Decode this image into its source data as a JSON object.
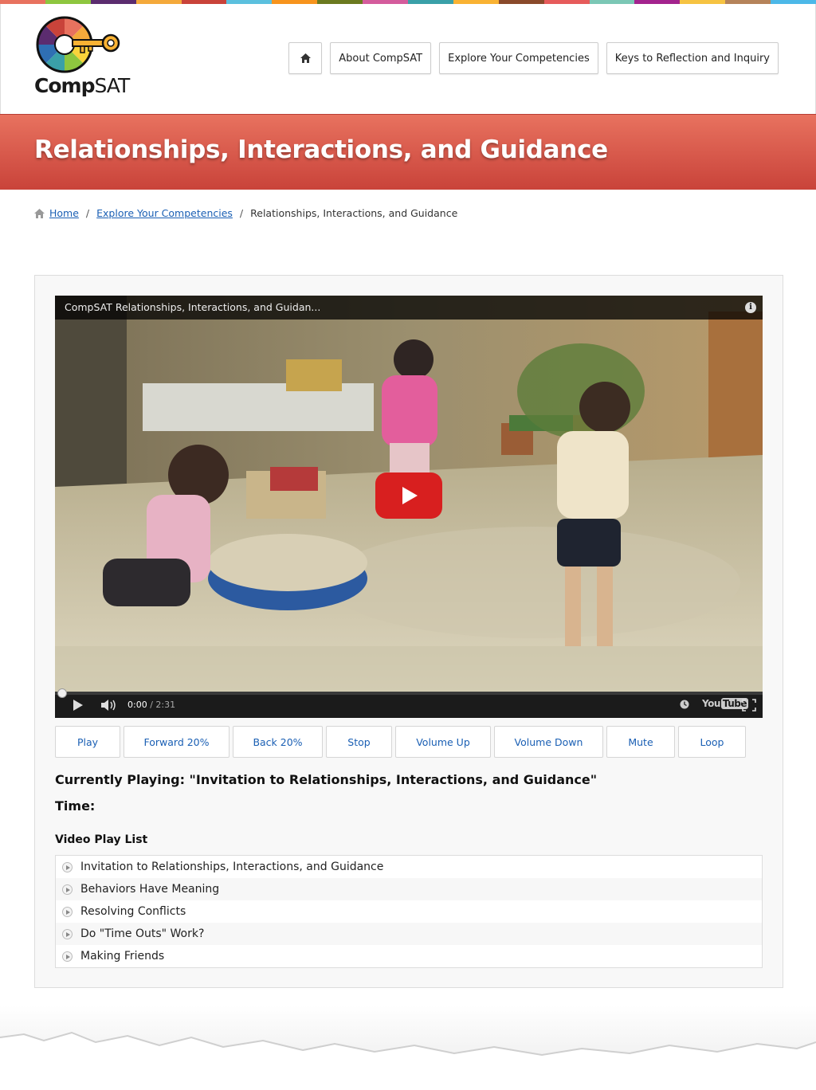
{
  "brand": {
    "logo_text_bold": "Comp",
    "logo_text_light": "SAT",
    "stripe_colors": [
      "#e8725f",
      "#8ec63f",
      "#5b2c6f",
      "#f4a93b",
      "#c9433a",
      "#5bc0de",
      "#f7941d",
      "#6b7a1f",
      "#d45c9c",
      "#3aa0a8",
      "#f9b233",
      "#8a4a2b",
      "#e65b5b",
      "#7bc7b5",
      "#a3238e",
      "#f6c342",
      "#b5835a",
      "#4cb8e8"
    ],
    "accent": "#c9433a",
    "link": "#1a5fb4"
  },
  "nav": {
    "home_icon": "home-icon",
    "items": [
      {
        "label": "About CompSAT"
      },
      {
        "label": "Explore Your Competencies"
      },
      {
        "label": "Keys to Reflection and Inquiry"
      }
    ]
  },
  "banner": {
    "title": "Relationships, Interactions, and Guidance"
  },
  "breadcrumb": {
    "home": "Home",
    "sep": "/",
    "parent": "Explore Your Competencies",
    "current": "Relationships, Interactions, and Guidance"
  },
  "video": {
    "title": "CompSAT Relationships, Interactions, and Guidan...",
    "info": "i",
    "time_current": "0:00",
    "time_total": "/ 2:31",
    "yt_you": "You",
    "yt_tube": "Tube",
    "progress": 0
  },
  "controls": [
    {
      "label": "Play"
    },
    {
      "label": "Forward 20%"
    },
    {
      "label": "Back 20%"
    },
    {
      "label": "Stop"
    },
    {
      "label": "Volume Up"
    },
    {
      "label": "Volume Down"
    },
    {
      "label": "Mute"
    },
    {
      "label": "Loop"
    }
  ],
  "status": {
    "now_playing": "Currently Playing: \"Invitation to Relationships, Interactions, and Guidance\"",
    "time_label": "Time:"
  },
  "playlist": {
    "title": "Video Play List",
    "items": [
      {
        "label": "Invitation to Relationships, Interactions, and Guidance"
      },
      {
        "label": "Behaviors Have Meaning"
      },
      {
        "label": "Resolving Conflicts"
      },
      {
        "label": "Do \"Time Outs\" Work?"
      },
      {
        "label": "Making Friends"
      }
    ]
  }
}
